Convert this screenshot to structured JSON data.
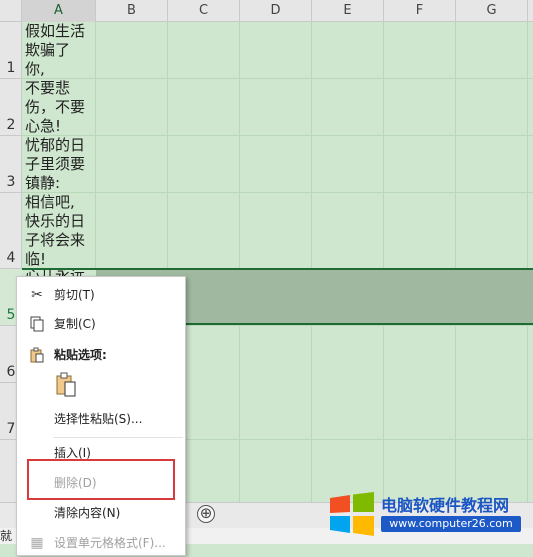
{
  "columns": [
    "A",
    "B",
    "C",
    "D",
    "E",
    "F",
    "G"
  ],
  "rows": [
    "1",
    "2",
    "3",
    "4",
    "5",
    "6",
    "7"
  ],
  "cells": {
    "a1": "假如生活\n欺骗了\n你,",
    "a2": "不要悲\n伤，不要\n心急!",
    "a3": "忧郁的日\n子里须要\n镇静:",
    "a4": "相信吧,\n快乐的日\n子将会来\n临!",
    "a5": "心儿永远"
  },
  "context_menu": {
    "cut": "剪切(T)",
    "copy": "复制(C)",
    "paste_options": "粘贴选项:",
    "paste_special": "选择性粘贴(S)...",
    "insert": "插入(I)",
    "delete": "删除(D)",
    "clear": "清除内容(N)",
    "format_cells": "设置单元格格式(F)..."
  },
  "sheet_bar": {
    "add_sheet": "⊕"
  },
  "status_bar": {
    "text": "就"
  },
  "watermark": {
    "title": "电脑软硬件教程网",
    "url": "www.computer26.com"
  },
  "colors": {
    "accent": "#1e6b35",
    "highlight": "#d63a3a"
  }
}
